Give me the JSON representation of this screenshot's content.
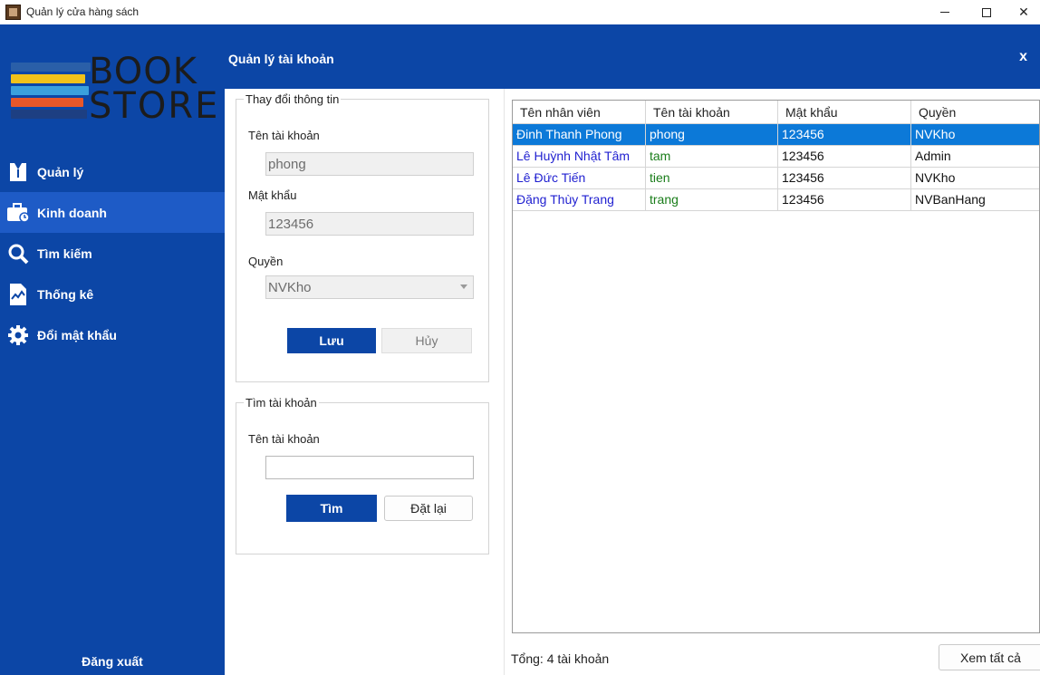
{
  "window": {
    "title": "Quản lý cửa hàng sách",
    "minimize": "—",
    "close": "✕"
  },
  "logo": {
    "line1": "BOOK",
    "line2": "STORE"
  },
  "sidebar": {
    "items": [
      {
        "label": "Quản lý",
        "icon": "badge-icon"
      },
      {
        "label": "Kinh doanh",
        "icon": "briefcase-icon"
      },
      {
        "label": "Tìm kiếm",
        "icon": "search-icon"
      },
      {
        "label": "Thống kê",
        "icon": "chart-doc-icon"
      },
      {
        "label": "Đổi mật khẩu",
        "icon": "gear-icon"
      }
    ],
    "logout_label": "Đăng xuất"
  },
  "header": {
    "title": "Quản lý tài khoản",
    "close": "x"
  },
  "edit_panel": {
    "legend": "Thay đổi thông tin",
    "username_label": "Tên tài khoản",
    "username_value": "phong",
    "password_label": "Mật khẩu",
    "password_value": "123456",
    "role_label": "Quyền",
    "role_value": "NVKho",
    "save_label": "Lưu",
    "cancel_label": "Hủy"
  },
  "search_panel": {
    "legend": "Tìm tài khoản",
    "username_label": "Tên tài khoản",
    "username_value": "",
    "search_label": "Tìm",
    "reset_label": "Đặt lại"
  },
  "table": {
    "columns": [
      "Tên nhân viên",
      "Tên tài khoản",
      "Mật khẩu",
      "Quyền"
    ],
    "rows": [
      [
        "Đinh Thanh Phong",
        "phong",
        "123456",
        "NVKho"
      ],
      [
        "Lê Huỳnh Nhật Tâm",
        "tam",
        "123456",
        "Admin"
      ],
      [
        "Lê Đức Tiến",
        "tien",
        "123456",
        "NVKho"
      ],
      [
        "Đặng Thùy Trang",
        "trang",
        "123456",
        "NVBanHang"
      ]
    ]
  },
  "footer": {
    "total": "Tổng: 4 tài khoản",
    "show_all_label": "Xem tất cả"
  },
  "colors": {
    "primary": "#0c46a6",
    "active_nav": "#1e5bc6",
    "selected_row": "#0c79d8"
  }
}
